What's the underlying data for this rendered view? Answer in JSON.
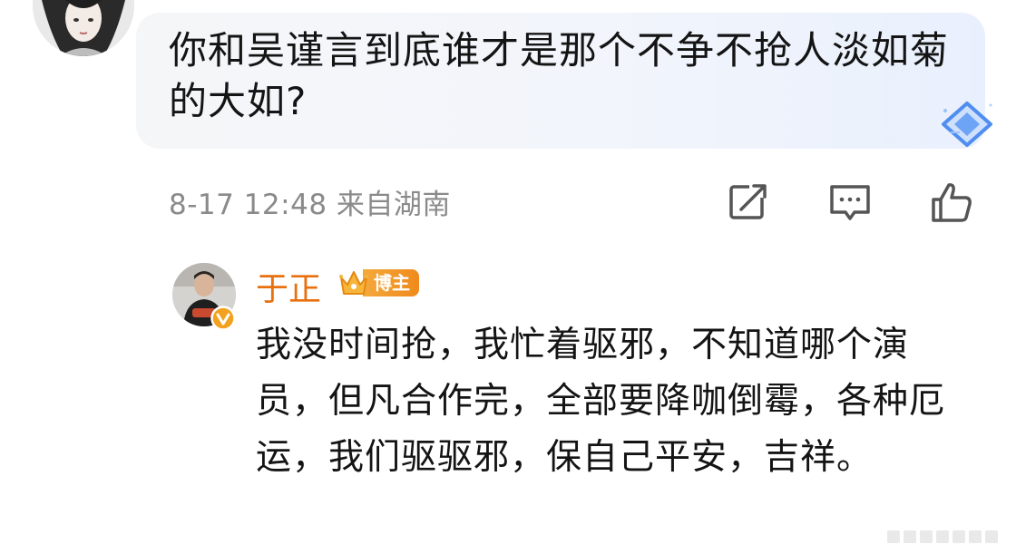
{
  "comment": {
    "text": "你和吴谨言到底谁才是那个不争不抢人淡如菊的大如?",
    "meta": "8-17 12:48 来自湖南"
  },
  "icons": {
    "share": "share-edit-icon",
    "comment": "comment-bubble-icon",
    "like": "thumbs-up-icon",
    "badge": "diamond-badge-icon",
    "verified": "verified-v-icon",
    "crown": "crown-icon"
  },
  "reply": {
    "author": "于正",
    "role_badge": "博主",
    "text": "我没时间抢，我忙着驱邪，不知道哪个演员，但凡合作完，全部要降咖倒霉，各种厄运，我们驱驱邪，保自己平安，吉祥。"
  },
  "colors": {
    "author": "#e8700f",
    "badge": "#f08a1c",
    "meta": "#8a8a8a"
  }
}
